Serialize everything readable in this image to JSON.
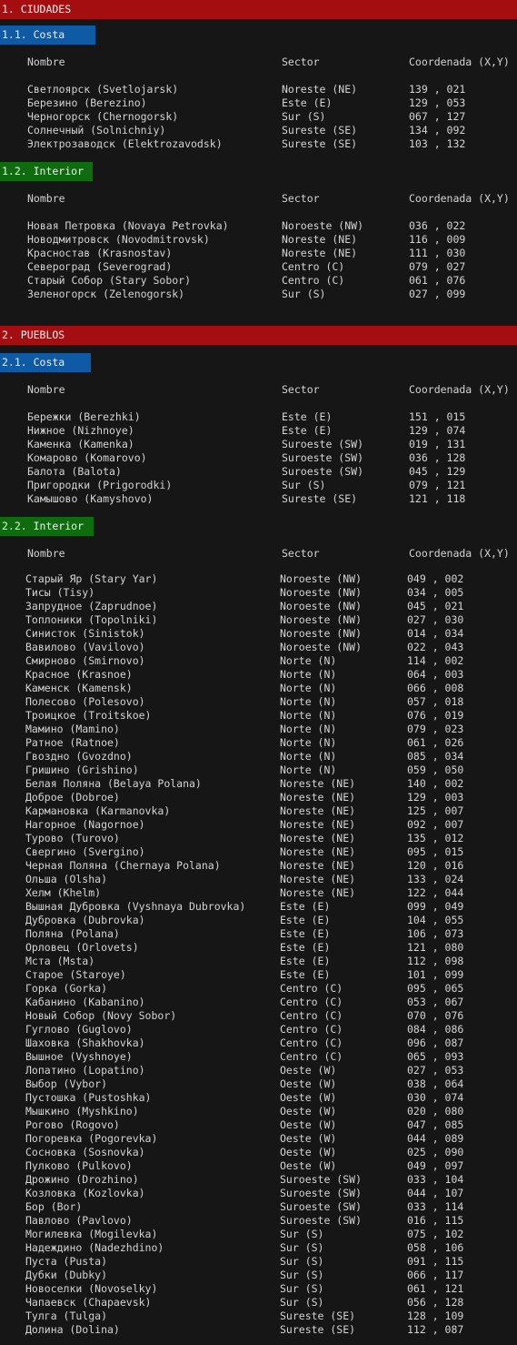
{
  "colors": {
    "section": "#a50e11",
    "costa": "#0e5aa5",
    "interior": "#0e6b0e",
    "bg": "#161616",
    "text": "#d4d4d4"
  },
  "headers": {
    "name": "Nombre",
    "sector": "Sector",
    "coord": "Coordenada (X,Y)"
  },
  "sections": [
    {
      "title": "1. CIUDADES",
      "subs": [
        {
          "title": "1.1. Costa",
          "rows": [
            [
              "Светлоярск (Svetlojarsk)",
              "Noreste (NE)",
              "139 , 021"
            ],
            [
              "Березино (Berezino)",
              "Este (E)",
              "129 , 053"
            ],
            [
              "Черногорск (Chernogorsk)",
              "Sur (S)",
              "067 , 127"
            ],
            [
              "Солнечный (Solnichniy)",
              "Sureste (SE)",
              "134 , 092"
            ],
            [
              "Электрозаводск (Elektrozavodsk)",
              "Sureste (SE)",
              "103 , 132"
            ]
          ]
        },
        {
          "title": "1.2. Interior",
          "rows": [
            [
              "Новая Петровка (Novaya Petrovka)",
              "Noroeste (NW)",
              "036 , 022"
            ],
            [
              "Новодмитровск (Novodmitrovsk)",
              "Noreste (NE)",
              "116 , 009"
            ],
            [
              "Красностав (Krasnostav)",
              "Noreste (NE)",
              "111 , 030"
            ],
            [
              "Североград (Severograd)",
              "Centro (C)",
              "079 , 027"
            ],
            [
              "Старый Собор (Stary Sobor)",
              "Centro (C)",
              "061 , 076"
            ],
            [
              "Зеленогорск (Zelenogorsk)",
              "Sur (S)",
              "027 , 099"
            ]
          ]
        }
      ]
    },
    {
      "title": "2. PUEBLOS",
      "subs": [
        {
          "title": "2.1. Costa",
          "rows": [
            [
              "Бережки (Berezhki)",
              "Este (E)",
              "151 , 015"
            ],
            [
              "Нижное (Nizhnoye)",
              "Este (E)",
              "129 , 074"
            ],
            [
              "Каменка (Kamenka)",
              "Suroeste (SW)",
              "019 , 131"
            ],
            [
              "Комарово (Komarovo)",
              "Suroeste (SW)",
              "036 , 128"
            ],
            [
              "Балота (Balota)",
              "Suroeste (SW)",
              "045 , 129"
            ],
            [
              "Пригородки (Prigorodki)",
              "Sur (S)",
              "079 , 121"
            ],
            [
              "Камышово (Kamyshovo)",
              "Sureste (SE)",
              "121 , 118"
            ]
          ]
        },
        {
          "title": "2.2. Interior",
          "rows": [
            [
              "Старый Яр (Stary Yar)",
              "Noroeste (NW)",
              "049 , 002"
            ],
            [
              "Тисы (Tisy)",
              "Noroeste (NW)",
              "034 , 005"
            ],
            [
              "Запрудное (Zaprudnoe)",
              "Noroeste (NW)",
              "045 , 021"
            ],
            [
              "Топлоники (Topolniki)",
              "Noroeste (NW)",
              "027 , 030"
            ],
            [
              "Синисток (Sinistok)",
              "Noroeste (NW)",
              "014 , 034"
            ],
            [
              "Вавилово (Vavilovo)",
              "Noroeste (NW)",
              "022 , 043"
            ],
            [
              "Смирново (Smirnovo)",
              "Norte (N)",
              "114 , 002"
            ],
            [
              "Красное (Krasnoe)",
              "Norte (N)",
              "064 , 003"
            ],
            [
              "Каменск (Kamensk)",
              "Norte (N)",
              "066 , 008"
            ],
            [
              "Полесово (Polesovo)",
              "Norte (N)",
              "057 , 018"
            ],
            [
              "Троицкое (Troitskoe)",
              "Norte (N)",
              "076 , 019"
            ],
            [
              "Мамино (Mamino)",
              "Norte (N)",
              "079 , 023"
            ],
            [
              "Ратное (Ratnoe)",
              "Norte (N)",
              "061 , 026"
            ],
            [
              "Гвоздно (Gvozdno)",
              "Norte (N)",
              "085 , 034"
            ],
            [
              "Гришино (Grishino)",
              "Norte (N)",
              "059 , 050"
            ],
            [
              "Белая Поляна (Belaya Polana)",
              "Noreste (NE)",
              "140 , 002"
            ],
            [
              "Доброе (Dobroe)",
              "Noreste (NE)",
              "129 , 003"
            ],
            [
              "Кармановка (Karmanovka)",
              "Noreste (NE)",
              "125 , 007"
            ],
            [
              "Нагорное (Nagornoe)",
              "Noreste (NE)",
              "092 , 007"
            ],
            [
              "Турово (Turovo)",
              "Noreste (NE)",
              "135 , 012"
            ],
            [
              "Свергино (Svergino)",
              "Noreste (NE)",
              "095 , 015"
            ],
            [
              "Черная Поляна (Chernaya Polana)",
              "Noreste (NE)",
              "120 , 016"
            ],
            [
              "Ольша (Olsha)",
              "Noreste (NE)",
              "133 , 024"
            ],
            [
              "Хелм (Khelm)",
              "Noreste (NE)",
              "122 , 044"
            ],
            [
              "Вышная Дубровка (Vyshnaya Dubrovka)",
              "Este (E)",
              "099 , 049"
            ],
            [
              "Дубровка (Dubrovka)",
              "Este (E)",
              "104 , 055"
            ],
            [
              "Поляна (Polana)",
              "Este (E)",
              "106 , 073"
            ],
            [
              "Орловец (Orlovets)",
              "Este (E)",
              "121 , 080"
            ],
            [
              "Мста (Msta)",
              "Este (E)",
              "112 , 098"
            ],
            [
              "Старое (Staroye)",
              "Este (E)",
              "101 , 099"
            ],
            [
              "Горка (Gorka)",
              "Centro (C)",
              "095 , 065"
            ],
            [
              "Кабанино (Kabanino)",
              "Centro (C)",
              "053 , 067"
            ],
            [
              "Новый Собор (Novy Sobor)",
              "Centro (C)",
              "070 , 076"
            ],
            [
              "Гуглово (Guglovo)",
              "Centro (C)",
              "084 , 086"
            ],
            [
              "Шаховка (Shakhovka)",
              "Centro (C)",
              "096 , 087"
            ],
            [
              "Вышное (Vyshnoye)",
              "Centro (C)",
              "065 , 093"
            ],
            [
              "Лопатино (Lopatino)",
              "Oeste (W)",
              "027 , 053"
            ],
            [
              "Выбор (Vybor)",
              "Oeste (W)",
              "038 , 064"
            ],
            [
              "Пустошка (Pustoshka)",
              "Oeste (W)",
              "030 , 074"
            ],
            [
              "Мышкино (Myshkino)",
              "Oeste (W)",
              "020 , 080"
            ],
            [
              "Рогово (Rogovo)",
              "Oeste (W)",
              "047 , 085"
            ],
            [
              "Погоревка (Pogorevka)",
              "Oeste (W)",
              "044 , 089"
            ],
            [
              "Сосновка (Sosnovka)",
              "Oeste (W)",
              "025 , 090"
            ],
            [
              "Пулково (Pulkovo)",
              "Oeste (W)",
              "049 , 097"
            ],
            [
              "Дрожино (Drozhino)",
              "Suroeste (SW)",
              "033 , 104"
            ],
            [
              "Козловка (Kozlovka)",
              "Suroeste (SW)",
              "044 , 107"
            ],
            [
              "Бор (Bor)",
              "Suroeste (SW)",
              "033 , 114"
            ],
            [
              "Павлово (Pavlovo)",
              "Suroeste (SW)",
              "016 , 115"
            ],
            [
              "Могилевка (Mogilevka)",
              "Sur (S)",
              "075 , 102"
            ],
            [
              "Надеждино (Nadezhdino)",
              "Sur (S)",
              "058 , 106"
            ],
            [
              "Пуста (Pusta)",
              "Sur (S)",
              "091 , 115"
            ],
            [
              "Дубки (Dubky)",
              "Sur (S)",
              "066 , 117"
            ],
            [
              "Новоселки (Novoselky)",
              "Sur (S)",
              "061 , 121"
            ],
            [
              "Чапаевск (Chapaevsk)",
              "Sur (S)",
              "056 , 128"
            ],
            [
              "Тулга (Tulga)",
              "Sureste (SE)",
              "128 , 109"
            ],
            [
              "Долина (Dolina)",
              "Sureste (SE)",
              "112 , 087"
            ]
          ]
        }
      ]
    }
  ]
}
